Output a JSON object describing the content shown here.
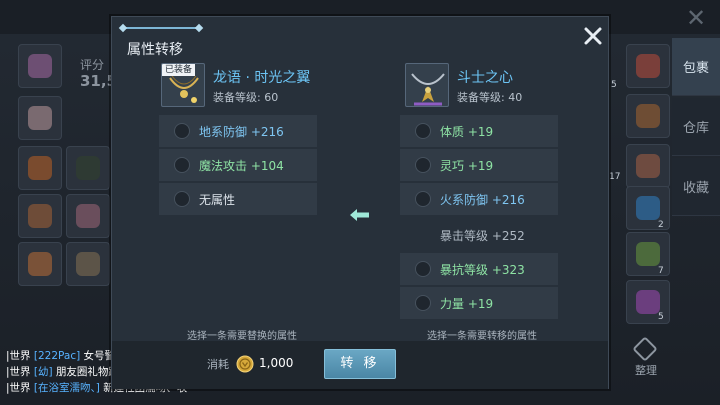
{
  "background": {
    "score_label": "评分",
    "score_value": "31,5",
    "side_tabs": [
      "包裹",
      "仓库",
      "收藏"
    ],
    "tidy_label": "整理",
    "slot_counts": [
      "5",
      "17",
      "2",
      "7",
      "5"
    ]
  },
  "modal": {
    "title": "属性转移",
    "source": {
      "badge": "已装备",
      "name": "龙语 · 时光之翼",
      "level": "装备等级:  60",
      "attributes": [
        {
          "label": "地系防御 +216",
          "tone": "blue",
          "selectable": true
        },
        {
          "label": "魔法攻击 +104",
          "tone": "green",
          "selectable": true
        },
        {
          "label": "无属性",
          "tone": "white",
          "selectable": true
        }
      ],
      "hint": "选择一条需要替换的属性"
    },
    "target": {
      "name": "斗士之心",
      "level": "装备等级:  40",
      "attributes": [
        {
          "label": "体质 +19",
          "tone": "green",
          "selectable": true
        },
        {
          "label": "灵巧 +19",
          "tone": "green",
          "selectable": true
        },
        {
          "label": "火系防御 +216",
          "tone": "blue",
          "selectable": true
        },
        {
          "label": "暴击等级 +252",
          "tone": "dim",
          "selectable": false
        },
        {
          "label": "暴抗等级 +323",
          "tone": "green",
          "selectable": true
        },
        {
          "label": "力量 +19",
          "tone": "green",
          "selectable": true
        }
      ],
      "hint": "选择一条需要转移的属性"
    },
    "cost_label": "消耗",
    "cost_value": "1,000",
    "transfer_button": "转 移"
  },
  "chat": [
    {
      "channel": "|世界",
      "sender": "[222Pac]",
      "message": "女号警告"
    },
    {
      "channel": "|世界",
      "sender": "[幼]",
      "message": "朋友圈礼物踩我一下谢谢"
    },
    {
      "channel": "|世界",
      "sender": "[在浴室濡吻、]",
      "message": "新建社团濡吻、收"
    }
  ],
  "colors": {
    "accent_blue": "#6cc4f4",
    "attr_green": "#8ee3a4",
    "attr_blue": "#7fc6f2",
    "button": "#5a96b4",
    "chat_sender": "#57b2ff"
  },
  "icons": [
    "close-icon",
    "arrow-left-icon",
    "coin-icon",
    "radio-icon",
    "wing-item-icon",
    "necklace-item-icon"
  ]
}
